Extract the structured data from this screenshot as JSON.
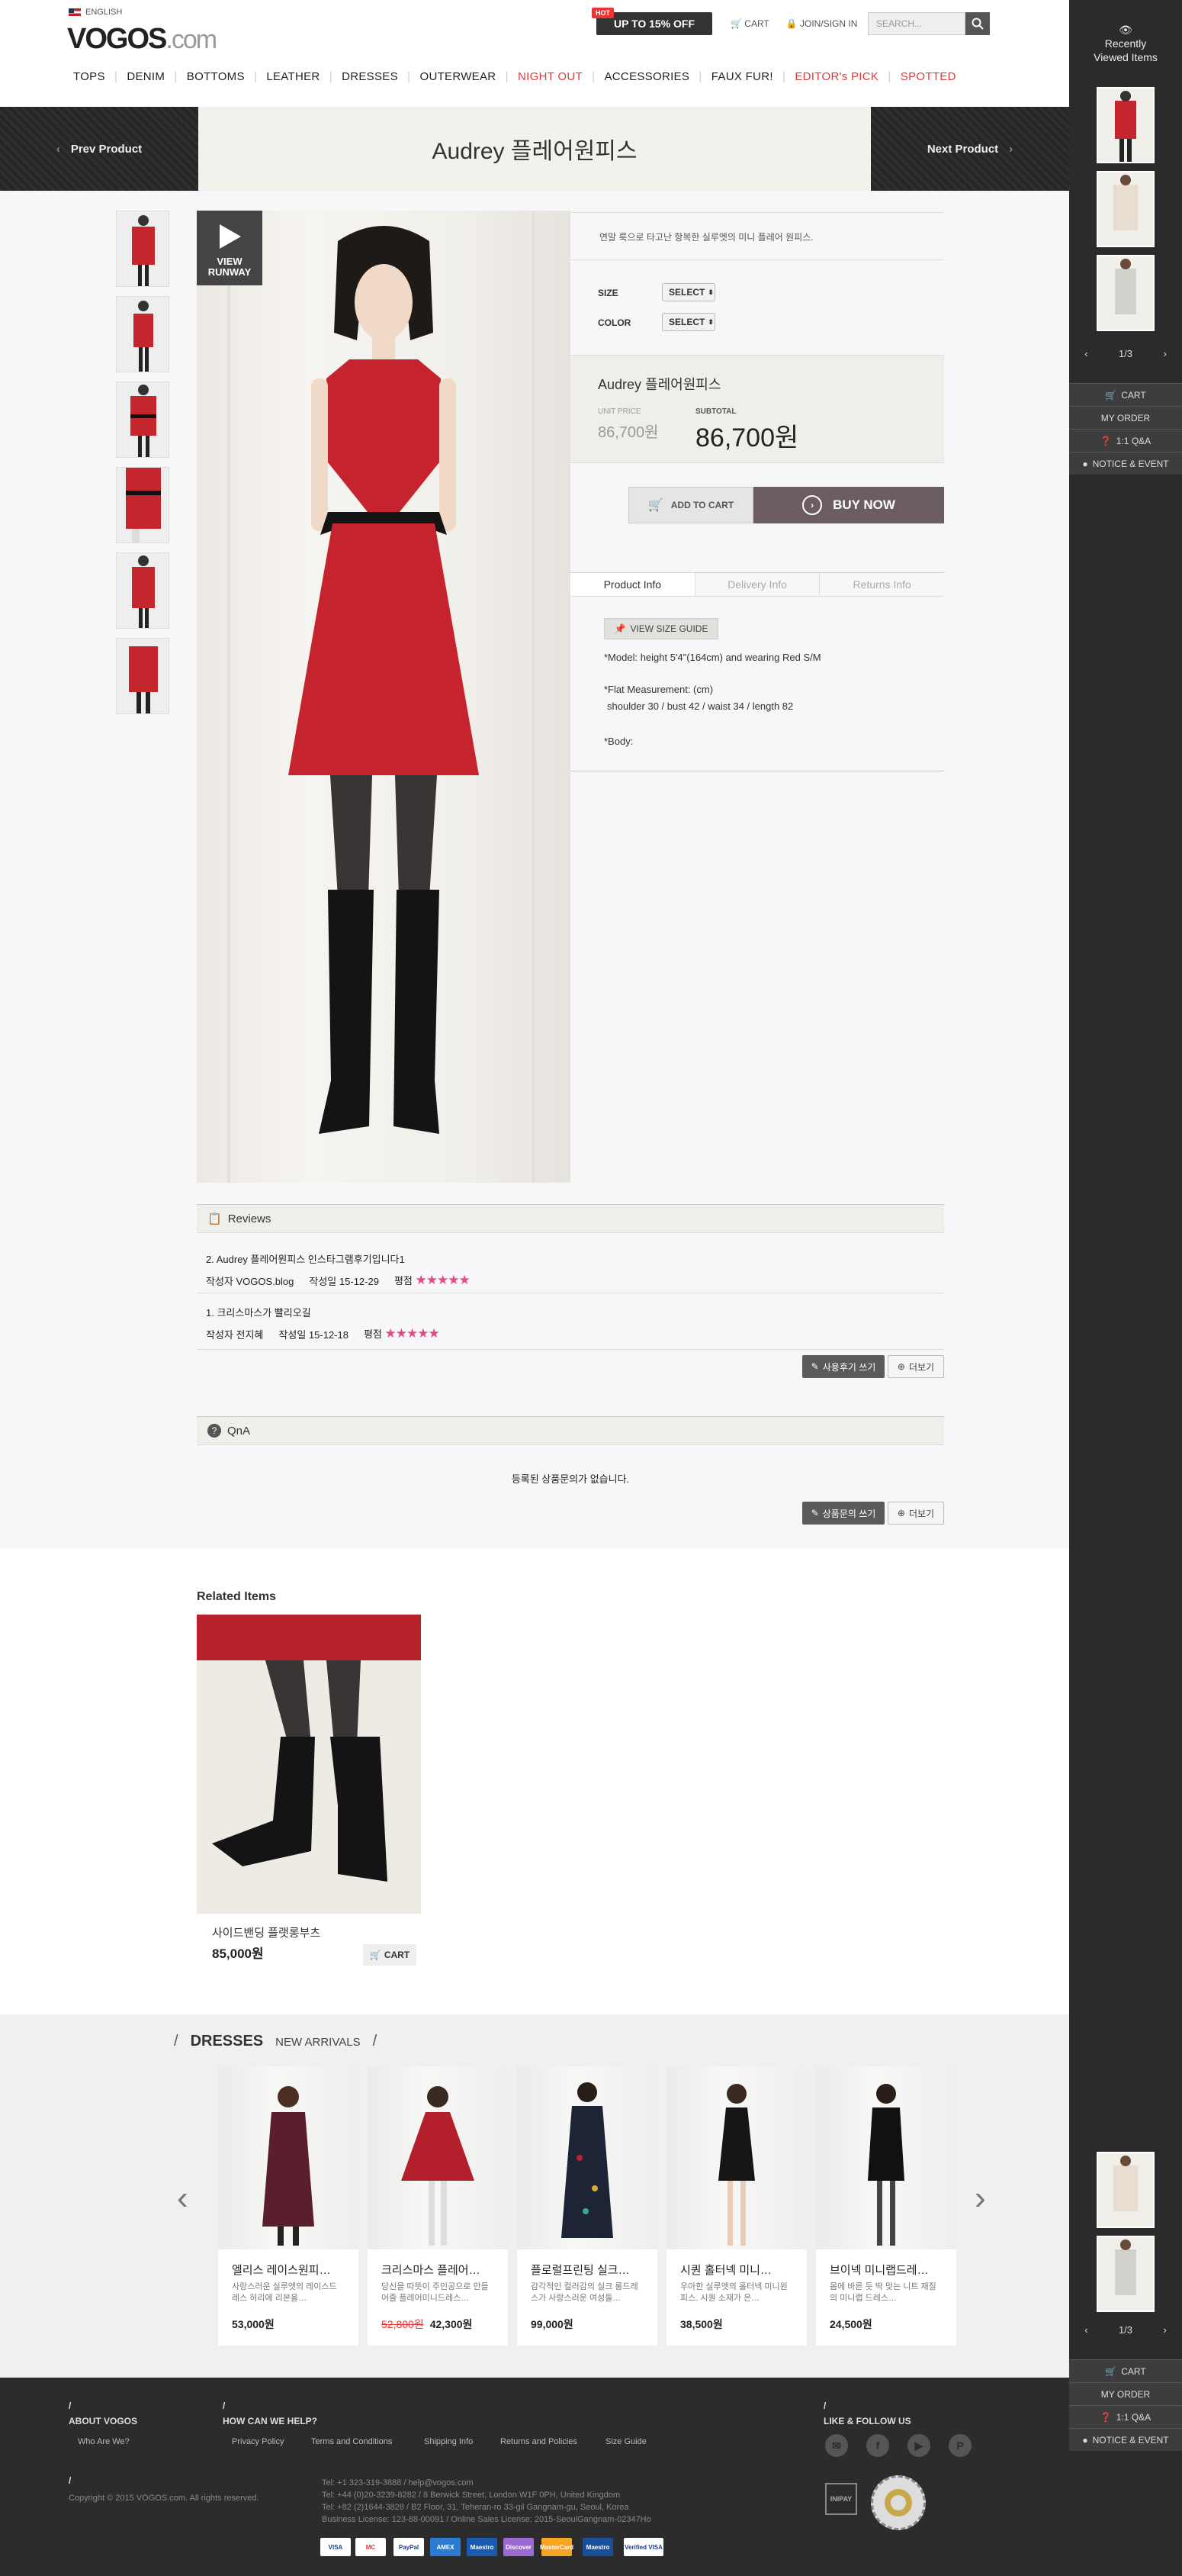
{
  "header": {
    "language": "ENGLISH",
    "logo": "VOGOS",
    "logo_suffix": ".com",
    "promo_badge": "HOT",
    "promo": "UP TO 15% OFF",
    "cart": "CART",
    "join": "JOIN/SIGN IN",
    "search_placeholder": "SEARCH...",
    "nav": [
      "TOPS",
      "DENIM",
      "BOTTOMS",
      "LEATHER",
      "DRESSES",
      "OUTERWEAR",
      "NIGHT OUT",
      "ACCESSORIES",
      "FAUX FUR!",
      "EDITOR's PICK",
      "SPOTTED"
    ]
  },
  "product_nav": {
    "prev": "Prev Product",
    "next": "Next Product",
    "title": "Audrey 플레어원피스"
  },
  "product": {
    "view_runway": "VIEW RUNWAY",
    "description": "연말 룩으로 타고난 항복한 실루엣의 미니 플레어 원피스.",
    "size_label": "SIZE",
    "size_value": "SELECT",
    "color_label": "COLOR",
    "color_value": "SELECT",
    "name": "Audrey 플레어원피스",
    "unit_price_label": "UNIT PRICE",
    "unit_price": "86,700원",
    "subtotal_label": "SUBTOTAL",
    "subtotal": "86,700원",
    "add_to_cart": "ADD TO CART",
    "buy_now": "BUY NOW",
    "tabs": [
      "Product Info",
      "Delivery Info",
      "Returns Info"
    ],
    "size_guide": "VIEW SIZE GUIDE",
    "model": "*Model: height 5'4\"(164cm) and wearing Red S/M",
    "flat_label": "*Flat Measurement: (cm)",
    "flat_values": "shoulder 30 / bust 42 / waist 34 / length 82",
    "body": "*Body:"
  },
  "reviews": {
    "title": "Reviews",
    "items": [
      {
        "title": "2. Audrey 플레어원피스 인스타그램후기입니다1",
        "author_label": "작성자",
        "author": "VOGOS.blog",
        "date_label": "작성일",
        "date": "15-12-29",
        "rating_label": "평점",
        "stars": "★★★★★"
      },
      {
        "title": "1. 크리스마스가 빨리오길",
        "author_label": "작성자",
        "author": "전지혜",
        "date_label": "작성일",
        "date": "15-12-18",
        "rating_label": "평점",
        "stars": "★★★★★"
      }
    ],
    "write": "사용후기 쓰기",
    "more": "더보기"
  },
  "qna": {
    "title": "QnA",
    "empty": "등록된 상품문의가 없습니다.",
    "write": "상품문의 쓰기",
    "more": "더보기"
  },
  "related": {
    "title": "Related Items",
    "name": "사이드밴딩 플랫롱부츠",
    "price": "85,000원",
    "cart": "CART"
  },
  "strip": {
    "category": "DRESSES",
    "sub": "NEW ARRIVALS",
    "items": [
      {
        "name": "엘리스 레이스원피…",
        "desc": "사랑스러운 실루엣의 레이스드 레스 허리에 리본을…",
        "price": "53,000원",
        "old": ""
      },
      {
        "name": "크리스마스 플레어…",
        "desc": "당신을 따뜻이 주인공으로 만들 어줄 플레어미니드레스…",
        "price": "42,300원",
        "old": "52,800원"
      },
      {
        "name": "플로럴프린팅 실크…",
        "desc": "감각적인 컬러감의 실크 롱드레 스가 사랑스러운 여성들…",
        "price": "99,000원",
        "old": ""
      },
      {
        "name": "시퀀 홀터넥 미니…",
        "desc": "우아한 실루엣의 홀터넥 미니원 피스. 시퀀 소재가 은…",
        "price": "38,500원",
        "old": ""
      },
      {
        "name": "브이넥 미니랩드레…",
        "desc": "몸에 바른 듯 딱 맞는 니트 재질 의 미니랩 드레스…",
        "price": "24,500원",
        "old": ""
      }
    ]
  },
  "footer": {
    "about": "ABOUT VOGOS",
    "who": "Who Are We?",
    "help": "HOW CAN WE HELP?",
    "help_links": [
      "Privacy Policy",
      "Terms and Conditions",
      "Shipping Info",
      "Returns and Policies",
      "Size Guide"
    ],
    "follow": "LIKE & FOLLOW US",
    "copyright": "Copyright © 2015 VOGOS.com. All rights reserved.",
    "contact": [
      "Tel: +1 323-319-3888 / help@vogos.com",
      "Tel: +44 (0)20-3239-8282 / 8 Berwick Street, London W1F 0PH, United Kingdom",
      "Tel: +82 (2)1644-3828 / B2 Floor, 31, Teheran-ro 33-gil Gangnam-gu, Seoul, Korea",
      "Business License: 123-88-00091 / Online Sales License: 2015-SeoulGangnam-02347Ho"
    ],
    "inipay": "INIPAY",
    "payments": [
      "VISA",
      "MC",
      "PayPal",
      "AMEX",
      "Maestro",
      "Discover",
      "MasterCard",
      "Maestro",
      "Verified VISA"
    ]
  },
  "sidebar": {
    "title_line1": "Recently",
    "title_line2": "Viewed Items",
    "pager": "1/3",
    "menu": [
      "CART",
      "MY ORDER",
      "1:1 Q&A",
      "NOTICE & EVENT"
    ]
  }
}
